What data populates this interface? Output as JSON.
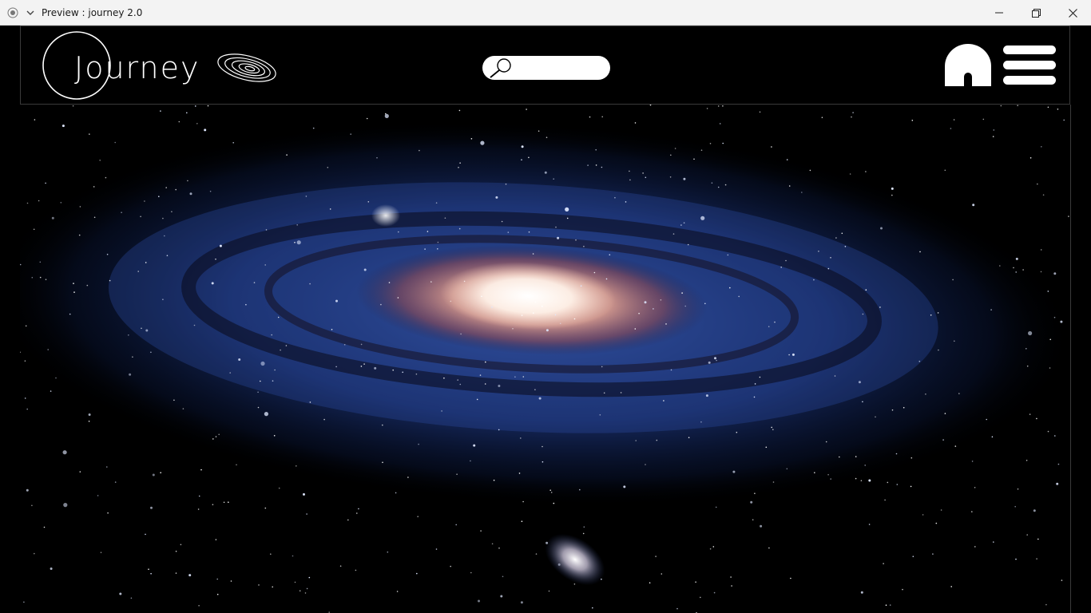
{
  "window": {
    "title": "Preview : journey 2.0",
    "icons": {
      "app": "record-icon",
      "dropdown": "chevron-down-icon",
      "minimize": "minimize-icon",
      "maximize": "restore-icon",
      "close": "close-icon"
    }
  },
  "header": {
    "logo_text": "Journey",
    "galaxy_icon": "spiral-galaxy-icon",
    "search": {
      "placeholder": "",
      "value": "",
      "icon": "search-icon"
    },
    "home_icon": "home-icon",
    "menu_icon": "hamburger-menu-icon"
  },
  "hero": {
    "image": "spiral-galaxy-image",
    "colors": {
      "core": "#fff6ee",
      "dust": "#c96a5a",
      "arms": "#2a4a9a",
      "background": "#000000"
    }
  }
}
